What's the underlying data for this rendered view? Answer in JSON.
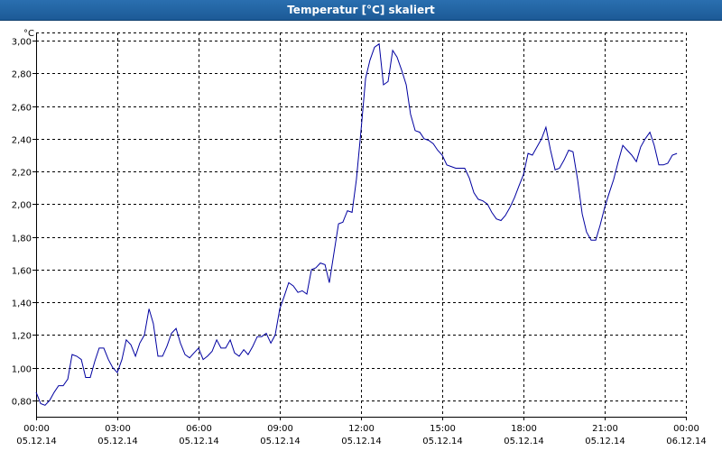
{
  "window": {
    "title": "Temperatur [°C] skaliert"
  },
  "chart_data": {
    "type": "line",
    "title": "Temperatur [°C] skaliert",
    "y_unit": "°C",
    "ylim": [
      0.7,
      3.05
    ],
    "y_ticks": [
      "0,80",
      "1,00",
      "1,20",
      "1,40",
      "1,60",
      "1,80",
      "2,00",
      "2,20",
      "2,40",
      "2,60",
      "2,80",
      "3,00"
    ],
    "y_tick_values": [
      0.8,
      1.0,
      1.2,
      1.4,
      1.6,
      1.8,
      2.0,
      2.2,
      2.4,
      2.6,
      2.8,
      3.0
    ],
    "x_ticks": [
      {
        "time": "00:00",
        "date": "05.12.14",
        "hour": 0
      },
      {
        "time": "03:00",
        "date": "05.12.14",
        "hour": 3
      },
      {
        "time": "06:00",
        "date": "05.12.14",
        "hour": 6
      },
      {
        "time": "09:00",
        "date": "05.12.14",
        "hour": 9
      },
      {
        "time": "12:00",
        "date": "05.12.14",
        "hour": 12
      },
      {
        "time": "15:00",
        "date": "05.12.14",
        "hour": 15
      },
      {
        "time": "18:00",
        "date": "05.12.14",
        "hour": 18
      },
      {
        "time": "21:00",
        "date": "05.12.14",
        "hour": 21
      },
      {
        "time": "00:00",
        "date": "06.12.14",
        "hour": 24
      }
    ],
    "grid": true,
    "series": [
      {
        "color": "#0000a0",
        "hours": [
          0,
          0.17,
          0.33,
          0.5,
          0.67,
          0.83,
          1.0,
          1.17,
          1.33,
          1.5,
          1.67,
          1.83,
          2.0,
          2.17,
          2.33,
          2.5,
          2.67,
          2.83,
          3.0,
          3.17,
          3.33,
          3.5,
          3.67,
          3.83,
          4.0,
          4.17,
          4.33,
          4.5,
          4.67,
          4.83,
          5.0,
          5.17,
          5.33,
          5.5,
          5.67,
          5.83,
          6.0,
          6.17,
          6.33,
          6.5,
          6.67,
          6.83,
          7.0,
          7.17,
          7.33,
          7.5,
          7.67,
          7.83,
          8.0,
          8.17,
          8.33,
          8.5,
          8.67,
          8.83,
          9.0,
          9.17,
          9.33,
          9.5,
          9.67,
          9.83,
          10.0,
          10.17,
          10.33,
          10.5,
          10.67,
          10.83,
          11.0,
          11.17,
          11.33,
          11.5,
          11.67,
          11.83,
          12.0,
          12.17,
          12.33,
          12.5,
          12.67,
          12.83,
          13.0,
          13.17,
          13.33,
          13.5,
          13.67,
          13.83,
          14.0,
          14.17,
          14.33,
          14.5,
          14.67,
          14.83,
          15.0,
          15.17,
          15.33,
          15.5,
          15.67,
          15.83,
          16.0,
          16.17,
          16.33,
          16.5,
          16.67,
          16.83,
          17.0,
          17.17,
          17.33,
          17.5,
          17.67,
          17.83,
          18.0,
          18.17,
          18.33,
          18.5,
          18.67,
          18.83,
          19.0,
          19.17,
          19.33,
          19.5,
          19.67,
          19.83,
          20.0,
          20.17,
          20.33,
          20.5,
          20.67,
          20.83,
          21.0,
          21.17,
          21.33,
          21.5,
          21.67,
          21.83,
          22.0,
          22.17,
          22.33,
          22.5,
          22.67,
          22.83,
          23.0,
          23.17,
          23.33,
          23.5,
          23.67
        ],
        "values": [
          0.85,
          0.78,
          0.77,
          0.8,
          0.85,
          0.89,
          0.89,
          0.93,
          1.08,
          1.07,
          1.05,
          0.94,
          0.94,
          1.04,
          1.12,
          1.12,
          1.05,
          1.0,
          0.97,
          1.05,
          1.17,
          1.14,
          1.07,
          1.15,
          1.2,
          1.36,
          1.27,
          1.07,
          1.07,
          1.13,
          1.21,
          1.24,
          1.15,
          1.08,
          1.06,
          1.09,
          1.12,
          1.05,
          1.07,
          1.1,
          1.17,
          1.12,
          1.12,
          1.17,
          1.09,
          1.07,
          1.11,
          1.08,
          1.13,
          1.19,
          1.19,
          1.21,
          1.15,
          1.2,
          1.36,
          1.44,
          1.52,
          1.5,
          1.46,
          1.47,
          1.45,
          1.6,
          1.61,
          1.64,
          1.63,
          1.52,
          1.7,
          1.88,
          1.89,
          1.96,
          1.95,
          2.15,
          2.45,
          2.77,
          2.88,
          2.96,
          2.98,
          2.73,
          2.75,
          2.94,
          2.9,
          2.82,
          2.73,
          2.55,
          2.45,
          2.44,
          2.4,
          2.39,
          2.37,
          2.33,
          2.3,
          2.24,
          2.23,
          2.22,
          2.22,
          2.22,
          2.16,
          2.07,
          2.03,
          2.02,
          2.0,
          1.95,
          1.91,
          1.9,
          1.93,
          1.98,
          2.04,
          2.11,
          2.18,
          2.31,
          2.3,
          2.35,
          2.4,
          2.47,
          2.33,
          2.21,
          2.22,
          2.27,
          2.33,
          2.32,
          2.15,
          1.94,
          1.83,
          1.78,
          1.78,
          1.87,
          1.98,
          2.07,
          2.15,
          2.26,
          2.36,
          2.33,
          2.3,
          2.26,
          2.35,
          2.4,
          2.44,
          2.36,
          2.24,
          2.24,
          2.25,
          2.3,
          2.31
        ]
      }
    ]
  }
}
